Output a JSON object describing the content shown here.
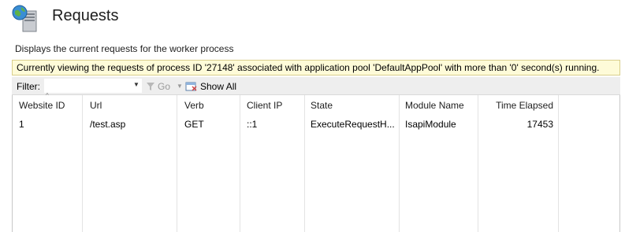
{
  "header": {
    "title": "Requests",
    "icon": "server-globe-icon"
  },
  "description": "Displays the current requests for the worker process",
  "banner": {
    "text": "Currently viewing the requests of process ID '27148' associated with application pool 'DefaultAppPool' with more than '0' second(s) running."
  },
  "toolbar": {
    "filter_label": "Filter:",
    "filter_value": "",
    "go_label": "Go",
    "show_all_label": "Show All"
  },
  "table": {
    "columns": [
      "Website ID",
      "Url",
      "Verb",
      "Client IP",
      "State",
      "Module Name",
      "Time Elapsed"
    ],
    "rows": [
      [
        "1",
        "/test.asp",
        "GET",
        "::1",
        "ExecuteRequestH...",
        "IsapiModule",
        "17453"
      ]
    ]
  },
  "colors": {
    "banner_bg": "#fefbd8",
    "toolbar_bg": "#eeeeee"
  }
}
